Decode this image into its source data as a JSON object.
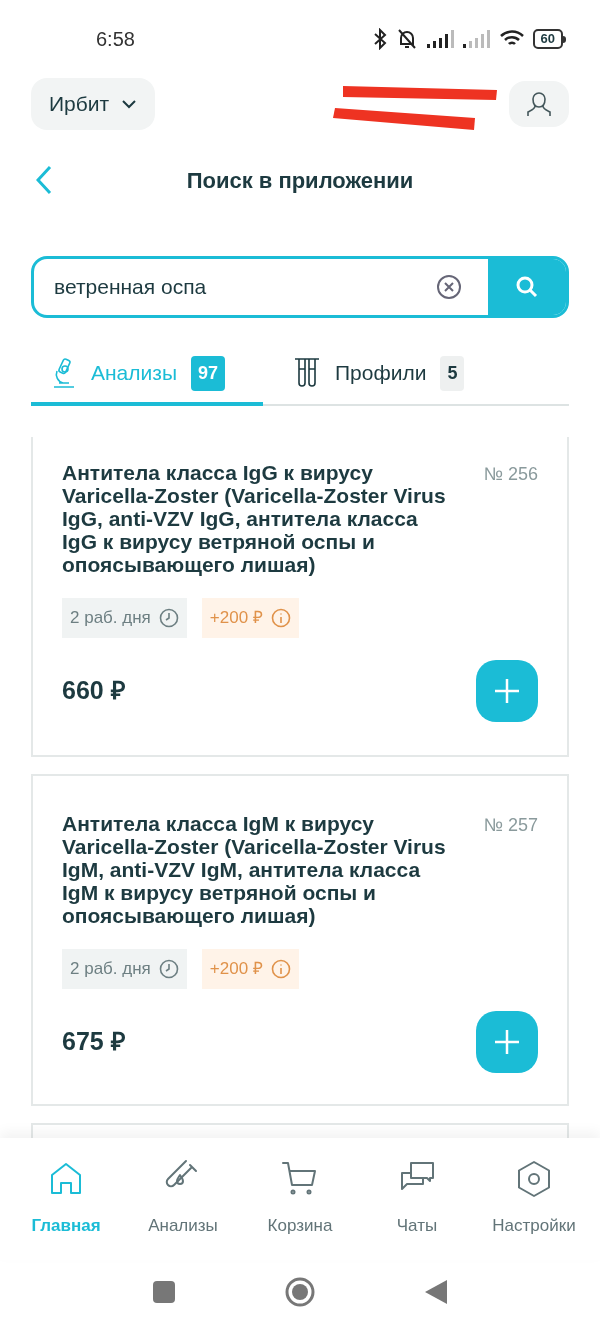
{
  "status_bar": {
    "time": "6:58",
    "battery": "60"
  },
  "header": {
    "city": "Ирбит"
  },
  "title": "Поиск в приложении",
  "search": {
    "value": "ветренная оспа"
  },
  "tabs": [
    {
      "label": "Анализы",
      "count": "97",
      "selected": true,
      "kind": "microscope"
    },
    {
      "label": "Профили",
      "count": "5",
      "selected": false,
      "kind": "tubes"
    }
  ],
  "results": [
    {
      "title": "Антитела класса IgG к вирусу Varicella-Zoster (Varicella-Zoster Virus IgG, anti-VZV IgG, антитела класса IgG к вирусу ветряной оспы и опоясывающего лишая)",
      "number": "№ 256",
      "duration": "2 раб. дня",
      "surcharge": "+200 ₽",
      "price": "660 ₽"
    },
    {
      "title": "Антитела класса IgM к вирусу Varicella-Zoster (Varicella-Zoster Virus IgM, anti-VZV IgM, антитела класса IgM к вирусу ветряной оспы и опоясывающего лишая)",
      "number": "№ 257",
      "duration": "2 раб. дня",
      "surcharge": "+200 ₽",
      "price": "675 ₽"
    }
  ],
  "bottom_nav": [
    {
      "label": "Главная",
      "kind": "home",
      "selected": true
    },
    {
      "label": "Анализы",
      "kind": "tube",
      "selected": false
    },
    {
      "label": "Корзина",
      "kind": "cart",
      "selected": false
    },
    {
      "label": "Чаты",
      "kind": "chat",
      "selected": false
    },
    {
      "label": "Настройки",
      "kind": "settings",
      "selected": false
    }
  ]
}
